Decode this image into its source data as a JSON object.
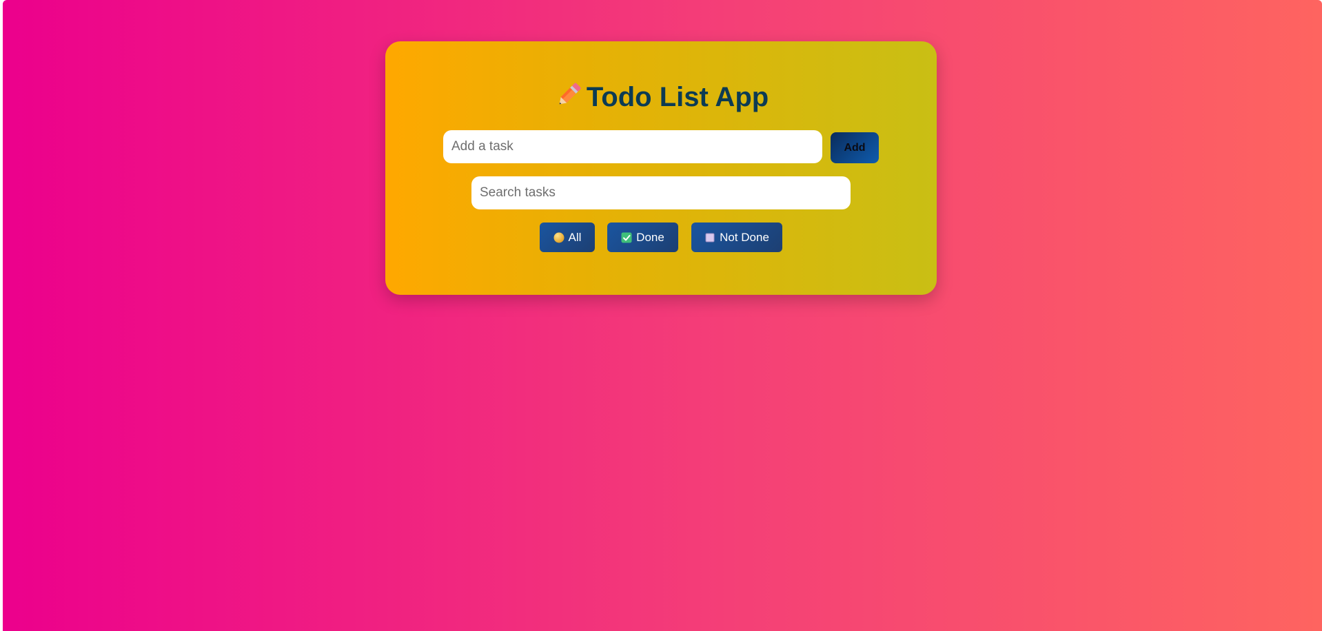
{
  "app": {
    "title": "Todo List App",
    "title_icon": "pencil-icon"
  },
  "task_entry": {
    "placeholder": "Add a task",
    "value": "",
    "add_label": "Add"
  },
  "search": {
    "placeholder": "Search tasks",
    "value": ""
  },
  "filters": [
    {
      "label": "All",
      "icon": "orange-circle-icon"
    },
    {
      "label": "Done",
      "icon": "check-box-icon"
    },
    {
      "label": "Not Done",
      "icon": "empty-square-icon"
    }
  ],
  "colors": {
    "page_gradient": [
      "#ec008c",
      "#fe6460"
    ],
    "card_gradient": [
      "#ffa800",
      "#c9bf14"
    ],
    "title_color": "#0c3b53",
    "button_color": "#1a55a0"
  }
}
